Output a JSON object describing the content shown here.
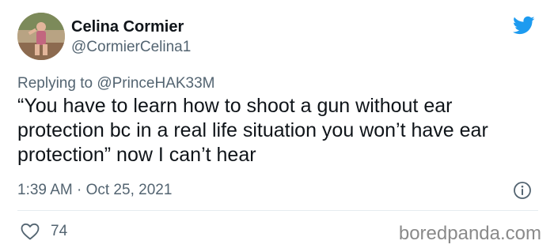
{
  "user": {
    "display_name": "Celina Cormier",
    "handle": "@CormierCelina1"
  },
  "reply": {
    "prefix": "Replying to ",
    "mention": "@PrinceHAK33M"
  },
  "tweet": {
    "text": "“You have to learn how to shoot a gun without ear protection bc in a real life situation you won’t have ear protection” now I can’t hear",
    "timestamp": "1:39 AM · Oct 25, 2021"
  },
  "stats": {
    "likes": "74"
  },
  "watermark": "boredpanda.com",
  "icons": {
    "brand": "twitter-bird-icon",
    "info": "info-icon",
    "like": "heart-icon"
  },
  "colors": {
    "twitter_blue": "#1d9bf0",
    "text_primary": "#0f1419",
    "text_secondary": "#536471"
  }
}
